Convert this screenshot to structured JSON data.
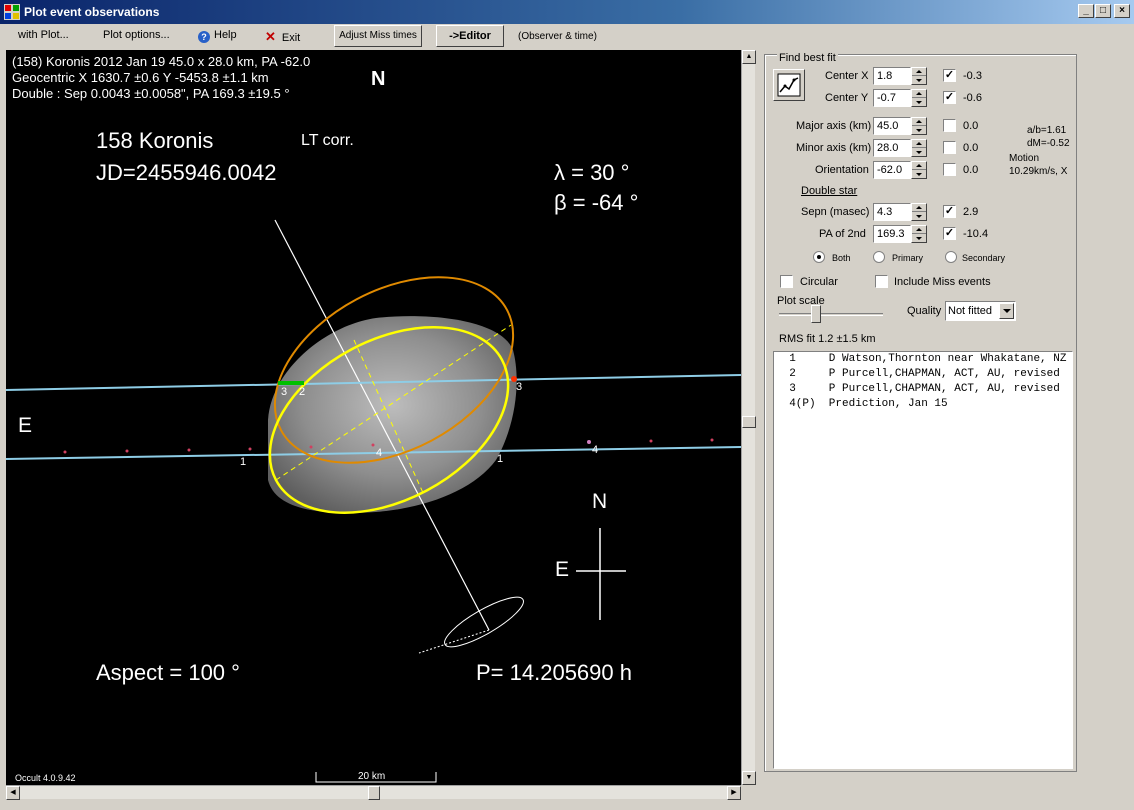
{
  "window": {
    "title": "Plot event observations",
    "minimize": "_",
    "maximize": "□",
    "close": "×"
  },
  "menu": {
    "with_plot": "with Plot...",
    "plot_options": "Plot options...",
    "help": "Help",
    "exit": "Exit",
    "adjust_miss": "Adjust Miss times",
    "editor": "->Editor",
    "observer_time": "(Observer & time)"
  },
  "plot": {
    "header1": "(158) Koronis  2012 Jan 19   45.0 x 28.0 km, PA -62.0",
    "header2": "Geocentric X 1630.7 ±0.6  Y -5453.8 ±1.1 km",
    "header3": "Double : Sep  0.0043 ±0.0058\", PA 169.3 ±19.5 °",
    "north_top": "N",
    "name": "158 Koronis",
    "lt_corr": "LT corr.",
    "jd": "JD=2455946.0042",
    "lambda": "λ =   30 °",
    "beta": "β =  -64 °",
    "east_left": "E",
    "compass_n": "N",
    "compass_e": "E",
    "aspect": "Aspect = 100 °",
    "period": "P= 14.205690 h",
    "version": "Occult 4.0.9.42",
    "scale": "20 km",
    "chord_labels": [
      "3",
      "2",
      "3",
      "1",
      "1",
      "4",
      "4"
    ]
  },
  "colors": {
    "fit_ellipse": "#ffff00",
    "secondary_ellipse": "#e08a00",
    "chord_line": "#8ecde6",
    "asteroid": "#9a9a9a"
  },
  "panel": {
    "find_best_fit": "Find best fit",
    "center_x": {
      "label": "Center X",
      "value": "1.8",
      "checked": true,
      "result": "-0.3"
    },
    "center_y": {
      "label": "Center Y",
      "value": "-0.7",
      "checked": true,
      "result": "-0.6"
    },
    "major": {
      "label": "Major axis (km)",
      "value": "45.0",
      "checked": false,
      "result": "0.0"
    },
    "minor": {
      "label": "Minor axis (km)",
      "value": "28.0",
      "checked": false,
      "result": "0.0"
    },
    "orientation": {
      "label": "Orientation",
      "value": "-62.0",
      "checked": false,
      "result": "0.0"
    },
    "ab_ratio": "a/b=1.61",
    "dm": "dM=-0.52",
    "motion": "Motion",
    "motion_value": "10.29km/s, X",
    "double_star": "Double star",
    "sepn": {
      "label": "Sepn (masec)",
      "value": "4.3",
      "checked": true,
      "result": "2.9"
    },
    "pa2": {
      "label": "PA of 2nd",
      "value": "169.3",
      "checked": true,
      "result": "-10.4"
    },
    "radio_both": "Both",
    "radio_primary": "Primary",
    "radio_secondary": "Secondary",
    "circular": "Circular",
    "include_miss": "Include Miss events",
    "plot_scale": "Plot scale",
    "quality": "Quality",
    "quality_value": "Not fitted",
    "rms": "RMS fit 1.2 ±1.5 km",
    "check_mark": "✓",
    "observations": [
      "  1     D Watson,Thornton near Whakatane, NZ",
      "  2     P Purcell,CHAPMAN, ACT, AU, revised",
      "  3     P Purcell,CHAPMAN, ACT, AU, revised",
      "  4(P)  Prediction, Jan 15"
    ]
  }
}
